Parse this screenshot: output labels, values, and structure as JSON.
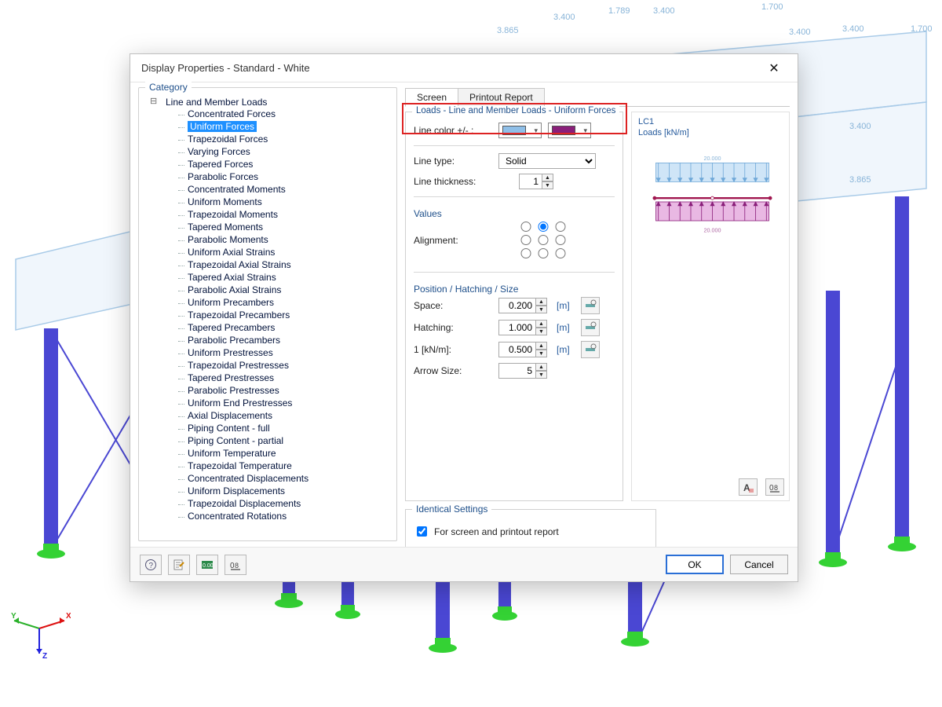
{
  "dialog": {
    "title": "Display Properties - Standard - White",
    "category_title": "Category",
    "tree_parent": "Line and Member Loads",
    "tree_items": [
      "Concentrated Forces",
      "Uniform Forces",
      "Trapezoidal Forces",
      "Varying Forces",
      "Tapered Forces",
      "Parabolic Forces",
      "Concentrated Moments",
      "Uniform Moments",
      "Trapezoidal Moments",
      "Tapered Moments",
      "Parabolic Moments",
      "Uniform Axial Strains",
      "Trapezoidal Axial Strains",
      "Tapered Axial Strains",
      "Parabolic Axial Strains",
      "Uniform Precambers",
      "Trapezoidal Precambers",
      "Tapered Precambers",
      "Parabolic Precambers",
      "Uniform Prestresses",
      "Trapezoidal Prestresses",
      "Tapered Prestresses",
      "Parabolic Prestresses",
      "Uniform End Prestresses",
      "Axial Displacements",
      "Piping Content - full",
      "Piping Content - partial",
      "Uniform Temperature",
      "Trapezoidal Temperature",
      "Concentrated Displacements",
      "Uniform Displacements",
      "Trapezoidal Displacements",
      "Concentrated Rotations"
    ],
    "tree_selected_index": 1,
    "tabs": {
      "screen": "Screen",
      "printout": "Printout Report"
    },
    "opts": {
      "title": "Loads - Line and Member Loads - Uniform Forces",
      "line_color_label": "Line color +/- :",
      "line_color_pos": "#8fbfe8",
      "line_color_neg": "#8a1f7a",
      "line_type_label": "Line type:",
      "line_type_value": "Solid",
      "line_thickness_label": "Line thickness:",
      "line_thickness_value": "1",
      "values_title": "Values",
      "alignment_label": "Alignment:",
      "alignment_selected": [
        0,
        1
      ],
      "pos_title": "Position / Hatching / Size",
      "space_label": "Space:",
      "space_value": "0.200",
      "hatching_label": "Hatching:",
      "hatching_value": "1.000",
      "knm_label": "1  [kN/m]:",
      "knm_value": "0.500",
      "arrow_label": "Arrow Size:",
      "arrow_value": "5",
      "unit_m": "[m]"
    },
    "preview": {
      "lc_label": "LC1",
      "units_label": "Loads [kN/m]",
      "top_value": "20.000",
      "bottom_value": "20.000"
    },
    "identical": {
      "title": "Identical Settings",
      "checkbox_label": "For screen and printout report",
      "checked": true
    },
    "buttons": {
      "ok": "OK",
      "cancel": "Cancel"
    }
  },
  "axes": {
    "x": "X",
    "y": "Y",
    "z": "Z"
  },
  "bg_labels": [
    "1.700",
    "3.400",
    "1.789",
    "3.400",
    "3.865",
    "1.700",
    "3.400",
    "3.865",
    "3.400",
    "3.865"
  ]
}
